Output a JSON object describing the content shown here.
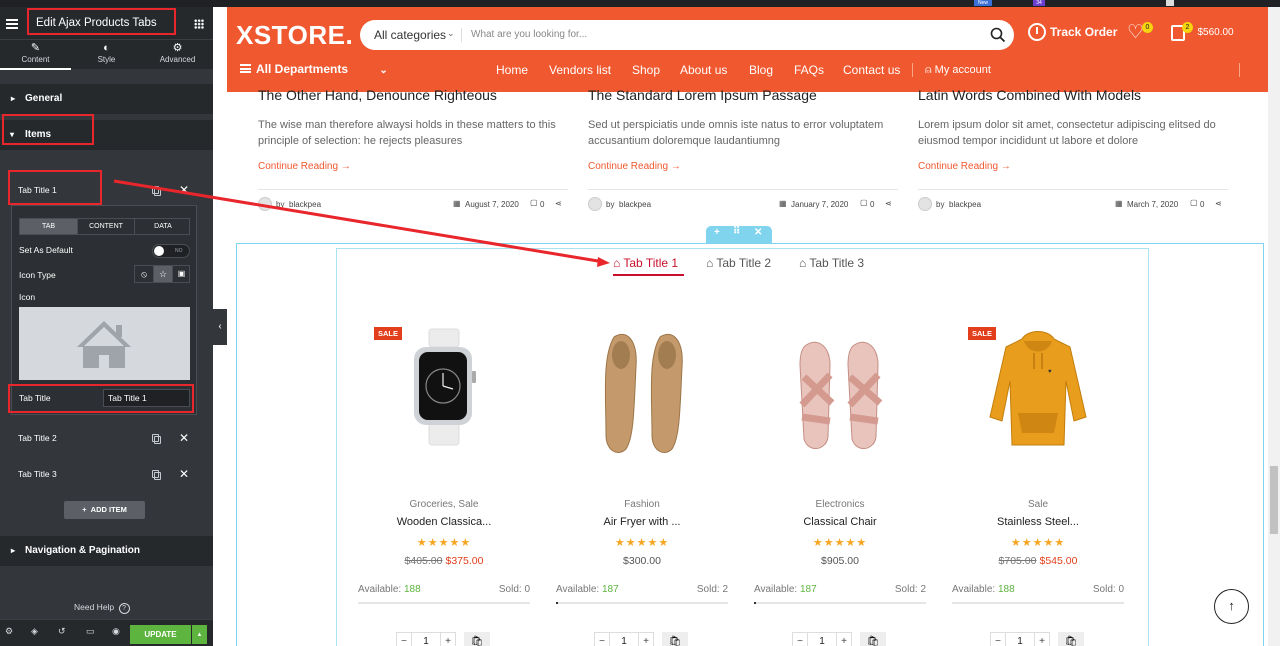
{
  "colors": {
    "accent": "#f0582f",
    "panel": "#33363b",
    "panel_dark": "#26292c",
    "green": "#5db53f",
    "editor_cyan": "#80d4ee",
    "sale": "#e2401c",
    "annotation": "#e8262b"
  },
  "browser_tabs": [
    "New",
    "34"
  ],
  "editor": {
    "title": "Edit Ajax Products Tabs",
    "tabs": [
      {
        "label": "Content",
        "icon": "pencil-icon"
      },
      {
        "label": "Style",
        "icon": "half-circle-icon"
      },
      {
        "label": "Advanced",
        "icon": "gear-icon"
      }
    ],
    "sections": {
      "general": "General",
      "items": "Items",
      "navigation": "Navigation & Pagination"
    },
    "items": [
      "Tab Title 1",
      "Tab Title 2",
      "Tab Title 3"
    ],
    "inner_tabs": [
      "TAB",
      "CONTENT",
      "DATA"
    ],
    "set_as_default_label": "Set As Default",
    "toggle_label": "NO",
    "icon_type_label": "Icon Type",
    "icon_label": "Icon",
    "tab_title_label": "Tab Title",
    "tab_title_value": "Tab Title 1",
    "add_item": "ADD ITEM",
    "need_help": "Need Help",
    "update": "UPDATE"
  },
  "site": {
    "logo": "XSTORE.",
    "categories": "All categories",
    "search_placeholder": "What are you looking for...",
    "track_order": "Track Order",
    "wishlist_count": "0",
    "cart_count": "2",
    "cart_total": "$560.00",
    "departments": "All Departments",
    "nav": [
      "Home",
      "Vendors list",
      "Shop",
      "About us",
      "Blog",
      "FAQs",
      "Contact us"
    ],
    "my_account": "My account"
  },
  "posts": [
    {
      "title": "The Other Hand, Denounce Righteous",
      "excerpt": "The wise man therefore alwaysi holds in these matters to this principle of selection: he rejects pleasures",
      "more": "Continue Reading",
      "by": "by",
      "author": "blackpea",
      "date": "August 7, 2020",
      "comments": "0"
    },
    {
      "title": "The Standard Lorem Ipsum Passage",
      "excerpt": "Sed ut perspiciatis unde omnis iste natus to error voluptatem accusantium doloremque laudantiumng",
      "more": "Continue Reading",
      "by": "by",
      "author": "blackpea",
      "date": "January 7, 2020",
      "comments": "0"
    },
    {
      "title": "Latin Words Combined With Models",
      "excerpt": "Lorem ipsum dolor sit amet, consectetur adipiscing elitsed do eiusmod tempor incididunt ut labore et dolore",
      "more": "Continue Reading",
      "by": "by",
      "author": "blackpea",
      "date": "March 7, 2020",
      "comments": "0"
    }
  ],
  "product_tabs": [
    "Tab Title 1",
    "Tab Title 2",
    "Tab Title 3"
  ],
  "products": [
    {
      "sale": "SALE",
      "category": "Groceries, Sale",
      "name": "Wooden Classica...",
      "old_price": "$405.00",
      "price": "$375.00",
      "available_label": "Available:",
      "available": "188",
      "sold_label": "Sold:",
      "sold": "0",
      "sold_fraction": 0.0,
      "qty": "1",
      "rating": 5,
      "image": "smartwatch"
    },
    {
      "sale": "",
      "category": "Fashion",
      "name": "Air Fryer with ...",
      "old_price": "",
      "price": "$300.00",
      "available_label": "Available:",
      "available": "187",
      "sold_label": "Sold:",
      "sold": "2",
      "sold_fraction": 0.01,
      "qty": "1",
      "rating": 5,
      "image": "loafers"
    },
    {
      "sale": "",
      "category": "Electronics",
      "name": "Classical Chair",
      "old_price": "",
      "price": "$905.00",
      "available_label": "Available:",
      "available": "187",
      "sold_label": "Sold:",
      "sold": "2",
      "sold_fraction": 0.01,
      "qty": "1",
      "rating": 5,
      "image": "sandals"
    },
    {
      "sale": "SALE",
      "category": "Sale",
      "name": "Stainless Steel...",
      "old_price": "$705.00",
      "price": "$545.00",
      "available_label": "Available:",
      "available": "188",
      "sold_label": "Sold:",
      "sold": "0",
      "sold_fraction": 0.0,
      "qty": "1",
      "rating": 5,
      "image": "hoodie"
    }
  ]
}
